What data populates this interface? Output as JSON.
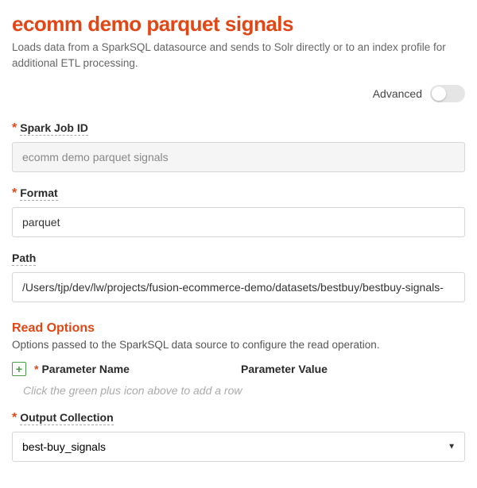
{
  "header": {
    "title": "ecomm demo parquet signals",
    "subtitle": "Loads data from a SparkSQL datasource and sends to Solr directly or to an index profile for additional ETL processing."
  },
  "advanced": {
    "label": "Advanced",
    "enabled": false
  },
  "fields": {
    "spark_job_id": {
      "label": "Spark Job ID",
      "value": "ecomm demo parquet signals",
      "required": true
    },
    "format": {
      "label": "Format",
      "value": "parquet",
      "required": true
    },
    "path": {
      "label": "Path",
      "value": "/Users/tjp/dev/lw/projects/fusion-ecommerce-demo/datasets/bestbuy/bestbuy-signals-",
      "required": false
    },
    "output_collection": {
      "label": "Output Collection",
      "value": "best-buy_signals",
      "required": true
    }
  },
  "read_options": {
    "heading": "Read Options",
    "description": "Options passed to the SparkSQL data source to configure the read operation.",
    "col_name": "Parameter Name",
    "col_value": "Parameter Value",
    "empty_hint": "Click the green plus icon above to add a row",
    "name_required": true
  }
}
